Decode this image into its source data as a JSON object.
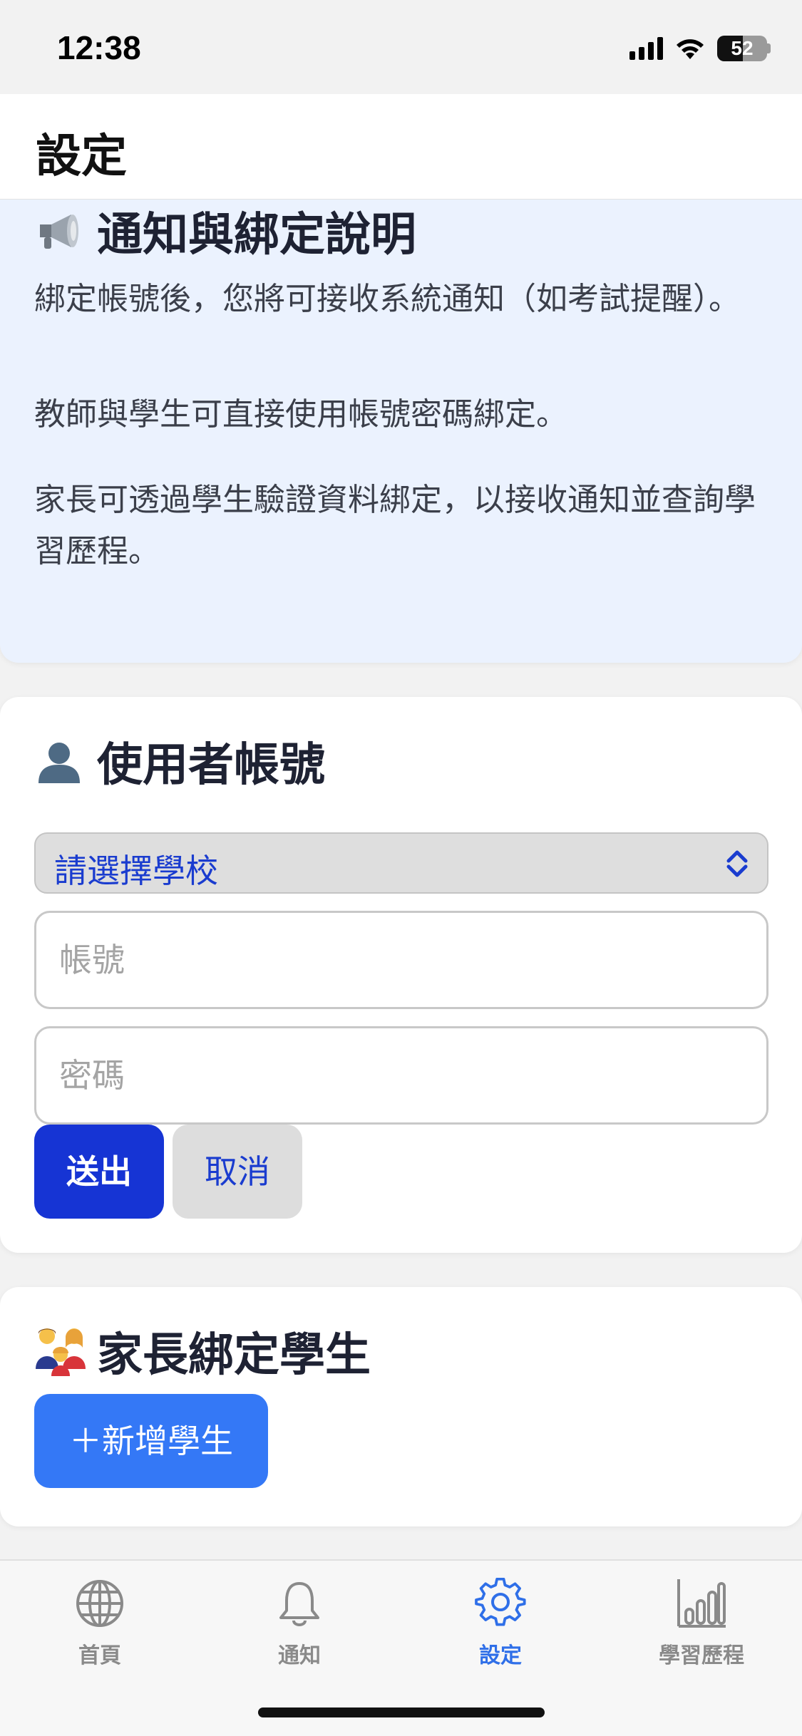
{
  "status_bar": {
    "time": "12:38",
    "battery": "52",
    "battery_level": 0.52,
    "icons": [
      "signal-icon",
      "wifi-icon",
      "battery-icon"
    ]
  },
  "header": {
    "title": "設定"
  },
  "info_card": {
    "icon": "megaphone-icon",
    "title": "通知與綁定說明",
    "paragraphs": [
      "綁定帳號後，您將可接收系統通知（如考試提醒）。",
      "教師與學生可直接使用帳號密碼綁定。",
      "家長可透過學生驗證資料綁定，以接收通知並查詢學習歷程。"
    ]
  },
  "account_card": {
    "icon": "user-silhouette-icon",
    "title": "使用者帳號",
    "school_select": {
      "selected": "請選擇學校",
      "icon": "chevron-up-down-icon"
    },
    "account_field": {
      "placeholder": "帳號",
      "value": ""
    },
    "password_field": {
      "placeholder": "密碼",
      "value": ""
    },
    "submit_label": "送出",
    "cancel_label": "取消"
  },
  "parent_card": {
    "icon": "family-icon",
    "title": "家長綁定學生",
    "add_label": "＋新增學生"
  },
  "tab_bar": {
    "items": [
      {
        "label": "首頁",
        "icon": "globe-icon",
        "active": false
      },
      {
        "label": "通知",
        "icon": "bell-icon",
        "active": false
      },
      {
        "label": "設定",
        "icon": "gear-icon",
        "active": true
      },
      {
        "label": "學習歷程",
        "icon": "bar-chart-icon",
        "active": false
      }
    ]
  },
  "colors": {
    "primary": "#1634d4",
    "accent_blue": "#3478f6",
    "active_tab": "#2f6fe8",
    "info_background": "#ebf2fe"
  }
}
